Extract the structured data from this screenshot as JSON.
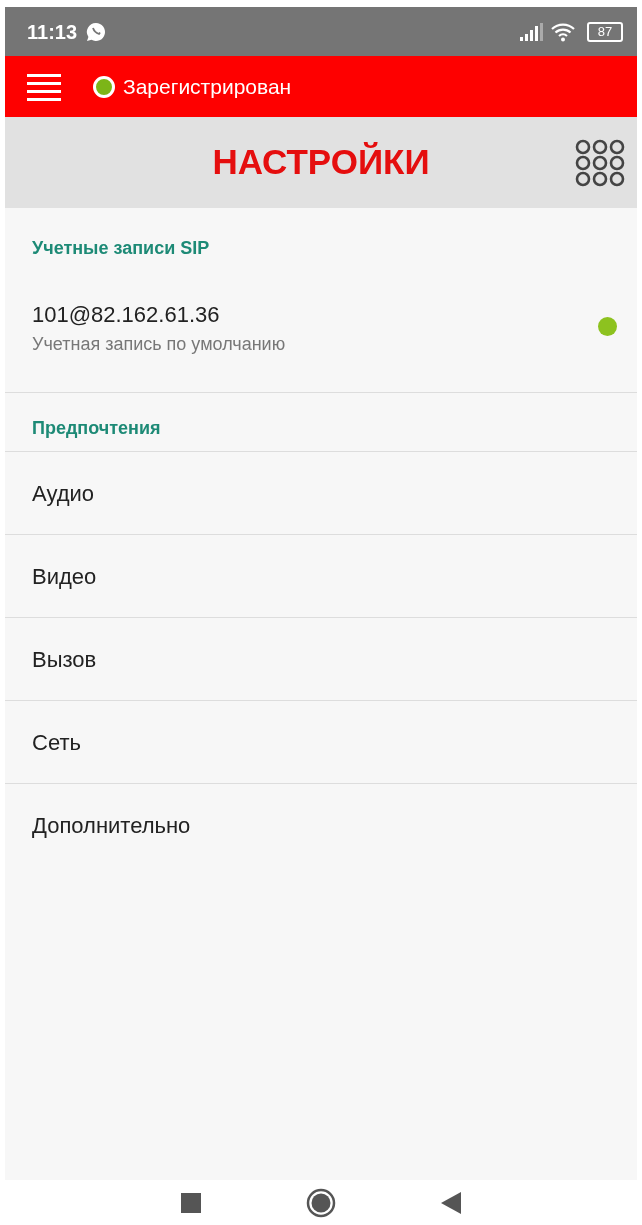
{
  "status_bar": {
    "time": "11:13",
    "battery": "87"
  },
  "app_bar": {
    "status": "Зарегистрирован",
    "status_dot": {
      "color": "#7cb518"
    }
  },
  "title": "НАСТРОЙКИ",
  "sections": [
    {
      "title": "Учетные записи SIP",
      "kind": "accounts",
      "items": [
        {
          "title": "101@82.162.61.36",
          "subtitle": "Учетная запись по умолчанию",
          "color": "#8dc21f"
        }
      ]
    },
    {
      "title": "Предпочтения",
      "kind": "menu",
      "items": [
        {
          "title": "Аудио"
        },
        {
          "title": "Видео"
        },
        {
          "title": "Вызов"
        },
        {
          "title": "Сеть"
        },
        {
          "title": "Дополнительно"
        }
      ]
    }
  ]
}
